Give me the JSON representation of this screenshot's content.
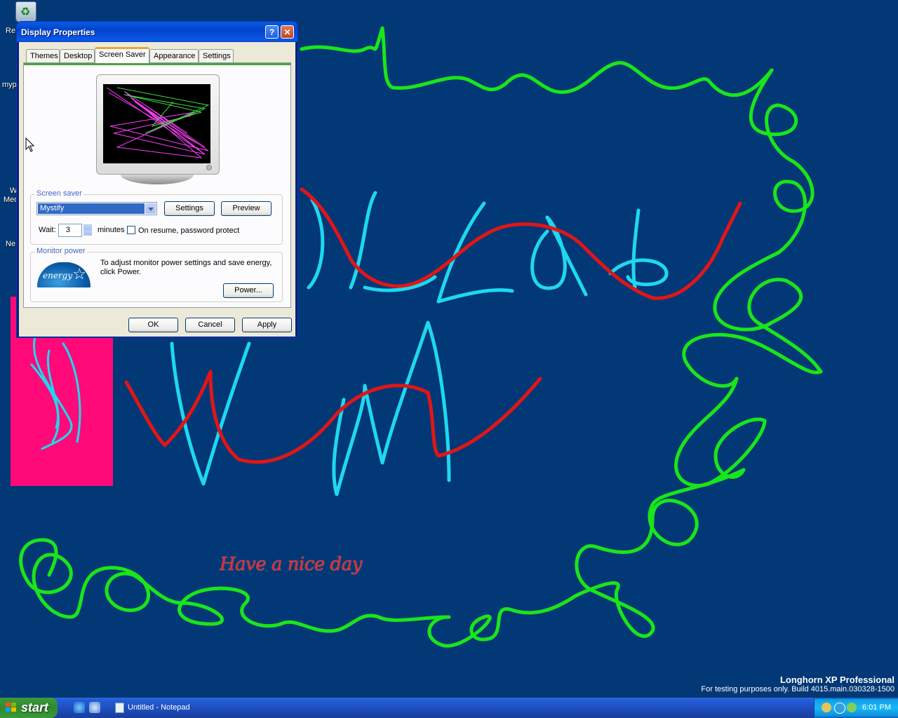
{
  "desktop": {
    "background_color": "#033876",
    "icon_labels": [
      "Re",
      "myp",
      "W",
      "Med",
      "Ne"
    ],
    "drawn_text": "Have a nice day",
    "version_title": "Longhorn XP Professional",
    "version_sub": "For testing purposes only. Build 4015.main.030328-1500"
  },
  "dialog": {
    "title": "Display Properties",
    "help_button": "?",
    "close_button": "✕",
    "tabs": [
      {
        "label": "Themes",
        "active": false
      },
      {
        "label": "Desktop",
        "active": false
      },
      {
        "label": "Screen Saver",
        "active": true
      },
      {
        "label": "Appearance",
        "active": false
      },
      {
        "label": "Settings",
        "active": false
      }
    ],
    "screen_saver": {
      "group_label": "Screen saver",
      "selected": "Mystify",
      "settings_button": "Settings",
      "preview_button": "Preview",
      "wait_label": "Wait:",
      "wait_value": "3",
      "minutes_label": "minutes",
      "password_protect_label": "On resume, password protect",
      "password_protect_checked": false
    },
    "monitor_power": {
      "group_label": "Monitor power",
      "description": "To adjust monitor power settings and save energy, click Power.",
      "power_button": "Power...",
      "logo_text": "energy"
    },
    "buttons": {
      "ok": "OK",
      "cancel": "Cancel",
      "apply": "Apply"
    }
  },
  "taskbar": {
    "start_label": "start",
    "task_title": "Untitled - Notepad",
    "clock": "6:01 PM"
  },
  "colors": {
    "scribble_green": "#19e619",
    "scribble_cyan": "#1ed8f0",
    "scribble_red": "#e01616",
    "pink_panel": "#ff0a78"
  }
}
